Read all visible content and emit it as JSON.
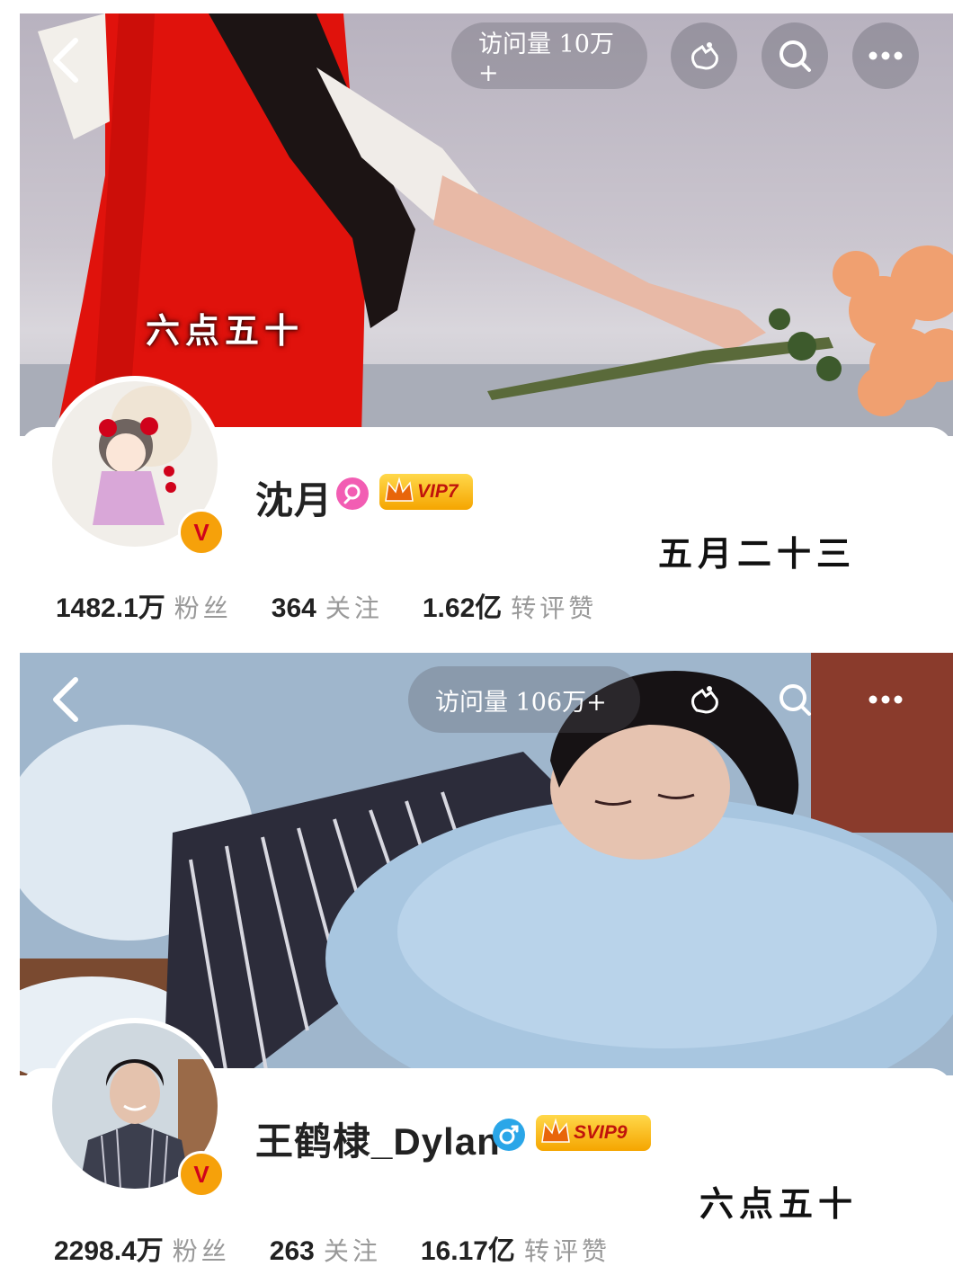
{
  "profiles": [
    {
      "visits": "访问量 10万+",
      "banner_caption": "六点五十",
      "name": "沈月",
      "gender_icon": "female-icon",
      "vip_label": "VIP7",
      "side_caption": "五月二十三",
      "followers_value": "1482.1万",
      "followers_label": "粉丝",
      "following_value": "364",
      "following_label": "关注",
      "interactions_value": "1.62亿",
      "interactions_label": "转评赞"
    },
    {
      "visits": "访问量 106万+",
      "name": "王鹤棣_Dylan",
      "gender_icon": "male-icon",
      "vip_label": "SVIP9",
      "side_caption": "六点五十",
      "followers_value": "2298.4万",
      "followers_label": "粉丝",
      "following_value": "263",
      "following_label": "关注",
      "interactions_value": "16.17亿",
      "interactions_label": "转评赞"
    }
  ],
  "colors": {
    "female_accent": "#f25db3",
    "male_accent": "#2aa6e8",
    "vip_gold": "#f5a500",
    "verified_orange": "#f6a10a"
  }
}
